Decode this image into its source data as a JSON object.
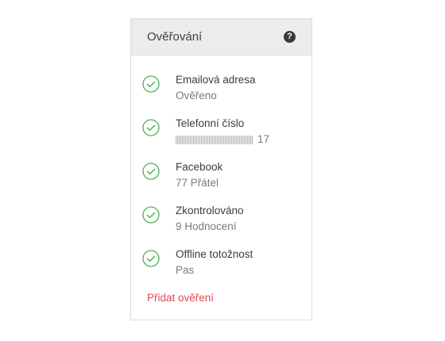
{
  "panel": {
    "title": "Ověřování",
    "help_icon": "question-circle-icon",
    "accent_color": "#4caf50",
    "link_color": "#e4474f"
  },
  "items": [
    {
      "label": "Emailová adresa",
      "value": "Ověřeno"
    },
    {
      "label": "Telefonní číslo",
      "value": "17",
      "masked": true
    },
    {
      "label": "Facebook",
      "value": "77 Přátel"
    },
    {
      "label": "Zkontrolováno",
      "value": "9 Hodnocení"
    },
    {
      "label": "Offline totožnost",
      "value": "Pas"
    }
  ],
  "add_link": "Přidat ověření"
}
